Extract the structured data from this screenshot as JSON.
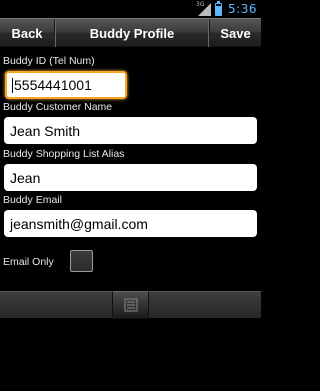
{
  "status_bar": {
    "network": "3G",
    "clock": "5:36",
    "icons": [
      "signal-3g-icon",
      "battery-icon"
    ]
  },
  "title_bar": {
    "back_label": "Back",
    "title": "Buddy Profile",
    "save_label": "Save"
  },
  "form": {
    "buddy_id": {
      "label": "Buddy ID (Tel Num)",
      "value": "5554441001"
    },
    "customer_name": {
      "label": "Buddy Customer Name",
      "value": "Jean Smith"
    },
    "shopping_list_alias": {
      "label": "Buddy Shopping List Alias",
      "value": "Jean"
    },
    "email": {
      "label": "Buddy Email",
      "value": "jeansmith@gmail.com"
    },
    "email_only": {
      "label": "Email Only",
      "checked": false
    }
  },
  "bottom_bar": {
    "icon": "menu-icon"
  },
  "colors": {
    "focus": "#f7a823",
    "status_accent": "#5fb8ff",
    "background": "#000000"
  }
}
